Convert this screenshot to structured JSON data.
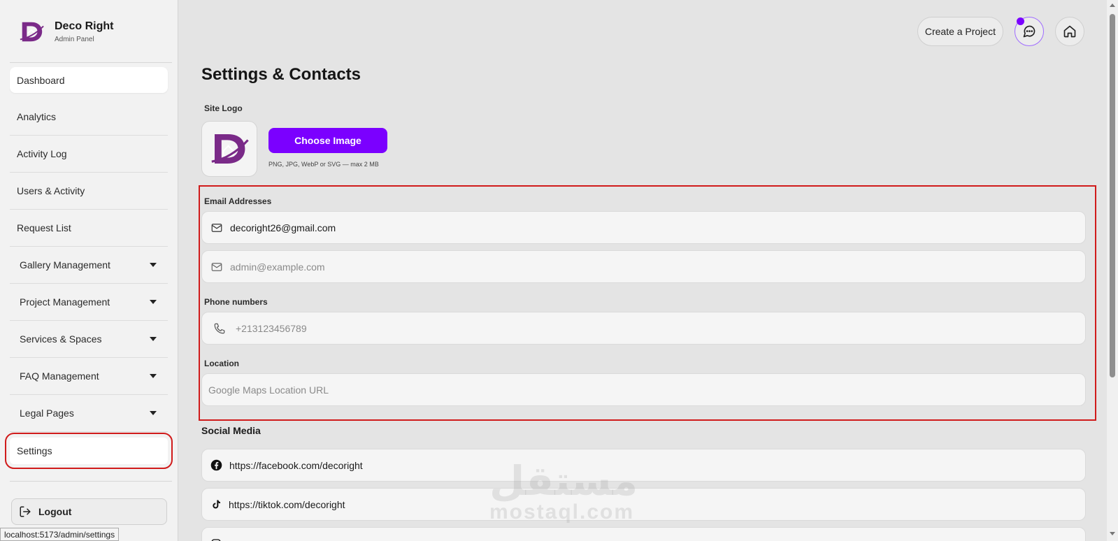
{
  "brand": {
    "name": "Deco Right",
    "subtitle": "Admin Panel",
    "color": "#7a2a88"
  },
  "sidebar": {
    "items": [
      {
        "label": "Dashboard"
      },
      {
        "label": "Analytics"
      },
      {
        "label": "Activity Log"
      },
      {
        "label": "Users & Activity"
      },
      {
        "label": "Request List"
      },
      {
        "label": "Gallery Management"
      },
      {
        "label": "Project Management"
      },
      {
        "label": "Services & Spaces"
      },
      {
        "label": "FAQ Management"
      },
      {
        "label": "Legal Pages"
      },
      {
        "label": "Settings"
      }
    ],
    "logout": "Logout"
  },
  "topbar": {
    "create_label": "Create a Project",
    "chat_icon": "chat-icon",
    "home_icon": "home-icon",
    "notify_color": "#7a00ff"
  },
  "page": {
    "title": "Settings & Contacts"
  },
  "site_logo": {
    "label": "Site Logo",
    "button": "Choose Image",
    "hint": "PNG, JPG, WebP or SVG — max 2 MB"
  },
  "emails": {
    "label": "Email Addresses",
    "primary": "decoright26@gmail.com",
    "secondary_placeholder": "admin@example.com"
  },
  "phones": {
    "label": "Phone numbers",
    "placeholder": "+213123456789"
  },
  "location": {
    "label": "Location",
    "placeholder": "Google Maps Location URL"
  },
  "social": {
    "title": "Social Media",
    "facebook": "https://facebook.com/decoright",
    "tiktok": "https://tiktok.com/decoright"
  },
  "status_url": "localhost:5173/admin/settings",
  "watermark": {
    "line1": "مستقل",
    "line2": "mostaql.com"
  },
  "colors": {
    "accent": "#7b00ff",
    "highlight": "#d01b1b"
  }
}
